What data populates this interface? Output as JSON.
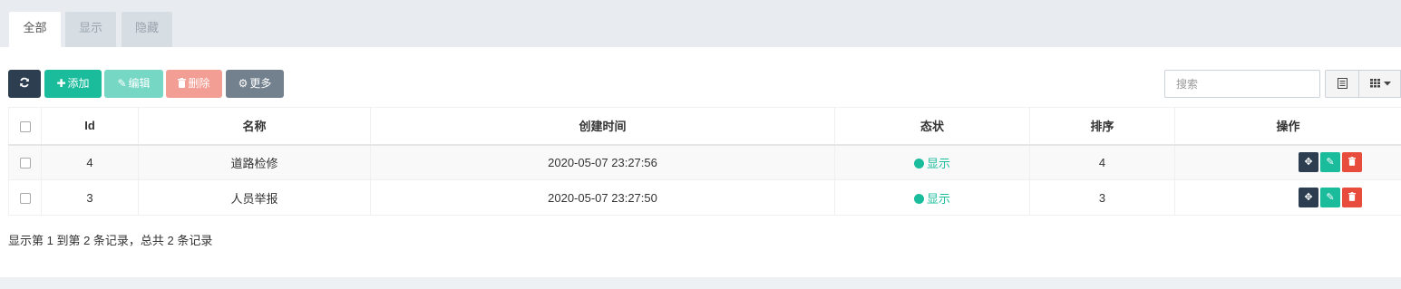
{
  "tabs": [
    {
      "label": "全部",
      "active": true
    },
    {
      "label": "显示",
      "active": false
    },
    {
      "label": "隐藏",
      "active": false
    }
  ],
  "toolbar": {
    "refresh_icon": "refresh-icon",
    "add_label": "添加",
    "edit_label": "编辑",
    "delete_label": "删除",
    "more_label": "更多"
  },
  "search": {
    "placeholder": "搜索",
    "value": ""
  },
  "table": {
    "headers": [
      "Id",
      "名称",
      "创建时间",
      "态状",
      "排序",
      "操作"
    ],
    "rows": [
      {
        "id": "4",
        "name": "道路检修",
        "created": "2020-05-07 23:27:56",
        "status": "显示",
        "weigh": "4"
      },
      {
        "id": "3",
        "name": "人员举报",
        "created": "2020-05-07 23:27:50",
        "status": "显示",
        "weigh": "3"
      }
    ]
  },
  "pagination": {
    "summary": "显示第 1 到第 2 条记录，总共 2 条记录"
  },
  "colors": {
    "primary_dark": "#2c3e50",
    "success": "#1abc9c",
    "danger": "#e74c3c",
    "gray": "#73808d"
  }
}
